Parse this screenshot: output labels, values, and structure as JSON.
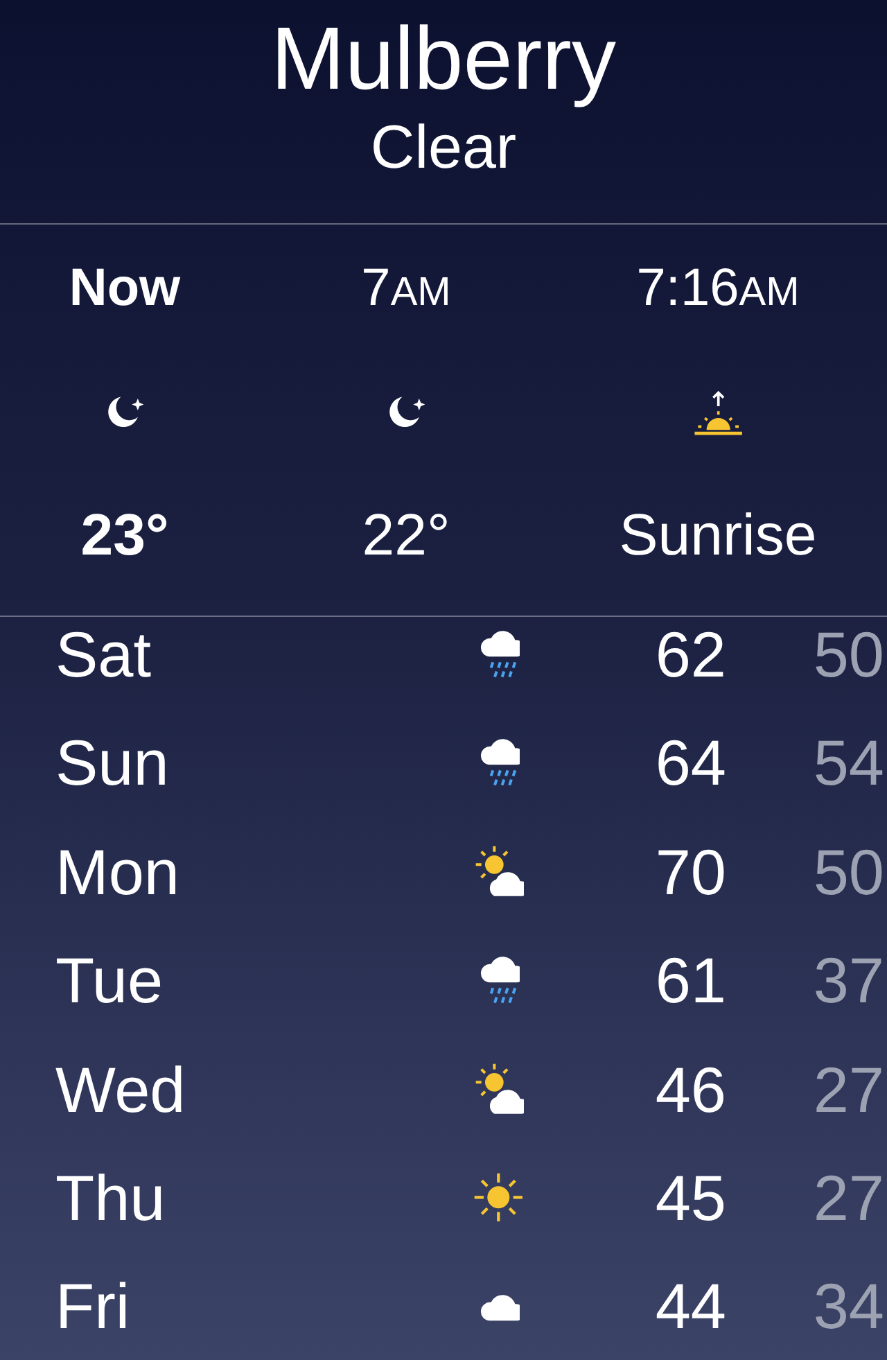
{
  "location": {
    "city": "Mulberry",
    "condition": "Clear"
  },
  "hourly": [
    {
      "time": "Now",
      "kind": "moon",
      "value": "23°",
      "current": true
    },
    {
      "time": "7",
      "suffix": "AM",
      "kind": "moon",
      "value": "22°",
      "current": false
    },
    {
      "time": "7:16",
      "suffix": "AM",
      "kind": "sunrise",
      "value": "Sunrise",
      "current": false
    }
  ],
  "daily": [
    {
      "day": "Sat",
      "kind": "rain",
      "high": "62",
      "low": "50"
    },
    {
      "day": "Sun",
      "kind": "rain",
      "high": "64",
      "low": "54"
    },
    {
      "day": "Mon",
      "kind": "partly-sunny",
      "high": "70",
      "low": "50"
    },
    {
      "day": "Tue",
      "kind": "rain",
      "high": "61",
      "low": "37"
    },
    {
      "day": "Wed",
      "kind": "partly-sunny",
      "high": "46",
      "low": "27"
    },
    {
      "day": "Thu",
      "kind": "sunny",
      "high": "45",
      "low": "27"
    },
    {
      "day": "Fri",
      "kind": "cloudy",
      "high": "44",
      "low": "34"
    }
  ]
}
